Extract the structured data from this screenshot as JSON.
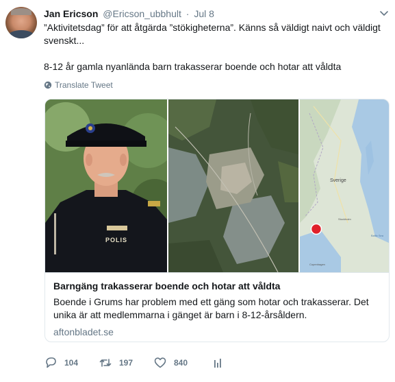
{
  "tweet": {
    "author_name": "Jan Ericson",
    "handle": "@Ericson_ubbhult",
    "separator": "·",
    "time": "Jul 8",
    "line1": "”Aktivitetsdag” för att åtgärda ”stökigheterna”. Känns så väldigt naivt och väldigt svenskt...",
    "line2": "8-12 år gamla nyanlända barn trakasserar boende och hotar att våldta",
    "translate_label": "Translate Tweet"
  },
  "card": {
    "title": "Barngäng trakasserar boende och hotar att våldta",
    "description": "Boende i Grums har problem med ett gäng som hotar och trakasserar. Det unika är att medlemmarna i gänget är barn i 8-12-årsåldern.",
    "domain": "aftonbladet.se",
    "police_badge_text": "POLIS",
    "map_labels": {
      "country": "Sverige",
      "city_stockholm": "Stockholm",
      "city_copenhagen": "Copenhagen",
      "sea": "Baltic Sea"
    }
  },
  "actions": {
    "reply_count": "104",
    "retweet_count": "197",
    "like_count": "840"
  },
  "colors": {
    "text": "#14171a",
    "muted": "#657786",
    "border": "#e1e8ed",
    "map_marker": "#e0202a"
  }
}
